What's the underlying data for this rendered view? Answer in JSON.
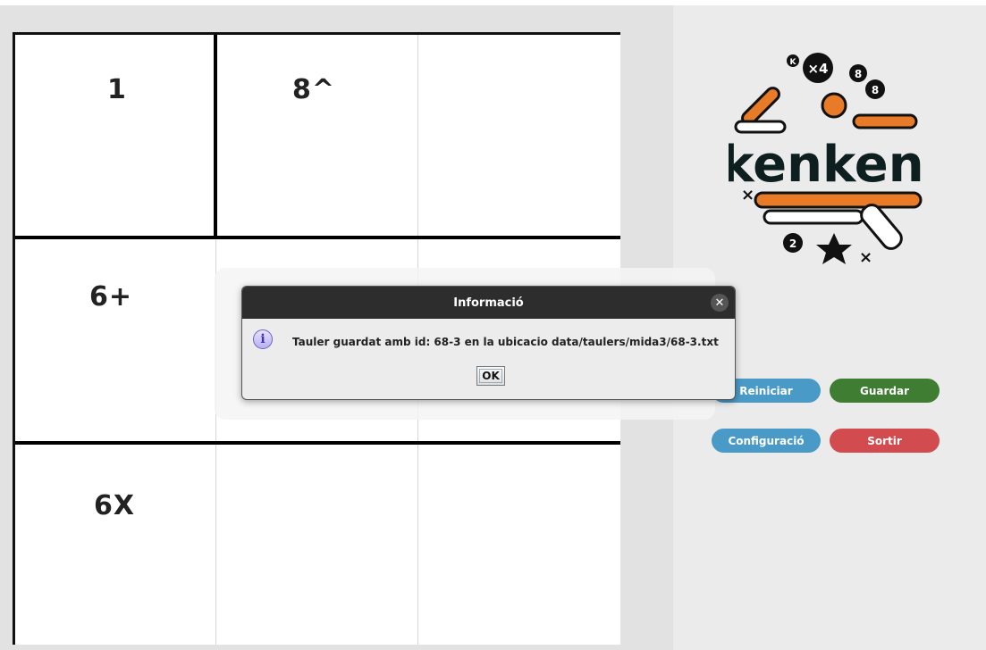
{
  "board": {
    "cages": [
      {
        "label": "1"
      },
      {
        "label": "8^"
      },
      {
        "label": "6+"
      },
      {
        "label": "6X"
      }
    ]
  },
  "logo": {
    "text": "kenken"
  },
  "buttons": {
    "reiniciar": "Reiniciar",
    "guardar": "Guardar",
    "configuracio": "Configuració",
    "sortir": "Sortir"
  },
  "colors": {
    "reiniciar": "#4a9ac8",
    "guardar": "#3e7d32",
    "configuracio": "#4a9ac8",
    "sortir": "#d24b4e"
  },
  "dialog": {
    "title": "Informació",
    "close_icon": "close-icon",
    "info_icon": "info-icon",
    "message": "Tauler guardat amb id: 68-3 en la ubicacio data/taulers/mida3/68-3.txt",
    "ok_label": "OK"
  }
}
